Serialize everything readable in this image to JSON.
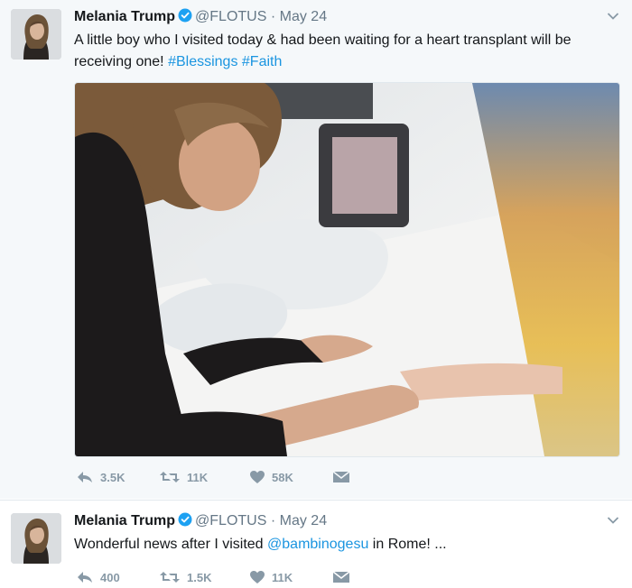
{
  "tweets": [
    {
      "name": "Melania Trump",
      "handle": "@FLOTUS",
      "separator": "·",
      "date": "May 24",
      "text_plain": "A little boy who I visited today & had been waiting for a heart transplant will be receiving one! ",
      "hashtag1": "#Blessings",
      "hashtag2": "#Faith",
      "replies": "3.5K",
      "retweets": "11K",
      "likes": "58K"
    },
    {
      "name": "Melania Trump",
      "handle": "@FLOTUS",
      "separator": "·",
      "date": "May 24",
      "text_start": "Wonderful news after I visited ",
      "mention": "@bambinogesu",
      "text_end": " in Rome! ...",
      "replies": "400",
      "retweets": "1.5K",
      "likes": "11K"
    }
  ],
  "colors": {
    "link": "#1b95e0",
    "verified": "#1da1f2",
    "action_gray": "#8899a6"
  },
  "icons": [
    "verified-badge-icon",
    "chevron-down-icon",
    "reply-icon",
    "retweet-icon",
    "heart-icon",
    "direct-message-icon"
  ]
}
